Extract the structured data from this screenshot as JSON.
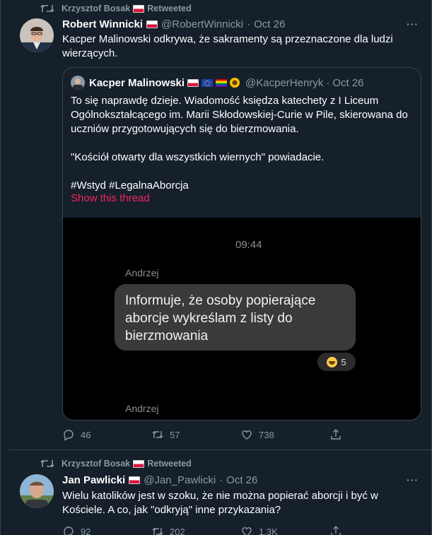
{
  "tweet1": {
    "retweet_by": "Krzysztof Bosak",
    "retweet_label": "Retweeted",
    "author_name": "Robert Winnicki",
    "author_handle": "@RobertWinnicki",
    "separator": "·",
    "date": "Oct 26",
    "text": "Kacper Malinowski odkrywa, że sakramenty są przeznaczone dla ludzi wierzących.",
    "quote": {
      "author_name": "Kacper Malinowski",
      "author_handle": "@KacperHenryk",
      "date": "Oct 26",
      "paragraph1": "To się naprawdę dzieje. Wiadomość księdza katechety z I Liceum Ogólnokształcącego im. Marii Skłodowskiej-Curie w Pile, skierowana do uczniów przygotowujących się do bierzmowania.",
      "paragraph2": "\"Kościół otwarty dla wszystkich wiernych\" powiadacie.",
      "paragraph3": "#Wstyd #LegalnaAborcja",
      "show_thread": "Show this thread",
      "media": {
        "time": "09:44",
        "sender": "Andrzej",
        "message": "Informuje, że osoby popierające aborcje wykreślam z listy do bierzmowania",
        "reaction_count": "5",
        "sender_next": "Andrzej"
      }
    },
    "replies": "46",
    "retweets": "57",
    "likes": "738"
  },
  "tweet2": {
    "retweet_by": "Krzysztof Bosak",
    "retweet_label": "Retweeted",
    "author_name": "Jan Pawlicki",
    "author_handle": "@Jan_Pawlicki",
    "separator": "·",
    "date": "Oct 26",
    "text": "Wielu katolików jest w szoku, że nie można popierać aborcji i być w Kościele. A co, jak \"odkryją\" inne przykazania?",
    "replies": "92",
    "retweets": "202",
    "likes": "1.3K"
  },
  "colors": {
    "background": "#15202b",
    "border": "#38444d",
    "muted": "#8b98a5",
    "link": "#f4245e"
  }
}
